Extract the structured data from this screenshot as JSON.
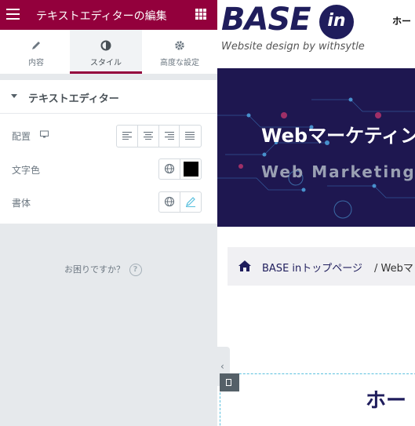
{
  "panel": {
    "title": "テキストエディターの編集",
    "accent_color": "#93003c",
    "tabs": [
      {
        "label": "内容",
        "icon": "pencil-icon"
      },
      {
        "label": "スタイル",
        "icon": "contrast-icon",
        "active": true
      },
      {
        "label": "高度な設定",
        "icon": "gear-icon"
      }
    ],
    "section": {
      "title": "テキストエディター",
      "controls": {
        "alignment": {
          "label": "配置",
          "options": [
            "left",
            "center",
            "right",
            "justify"
          ]
        },
        "text_color": {
          "label": "文字色",
          "value": "#000000"
        },
        "typography": {
          "label": "書体"
        }
      }
    },
    "help_text": "お困りですか？",
    "help_icon_glyph": "?"
  },
  "preview": {
    "logo": {
      "main": "BASE",
      "badge": "in",
      "tagline": "Website design by withsytle"
    },
    "nav": {
      "home": "ホー"
    },
    "hero": {
      "title": "Webマーケティン",
      "subtitle": "Web Marketing S"
    },
    "breadcrumb": {
      "link": "BASE inトップページ",
      "current": "/ Webマ"
    },
    "heading": "ホー"
  }
}
